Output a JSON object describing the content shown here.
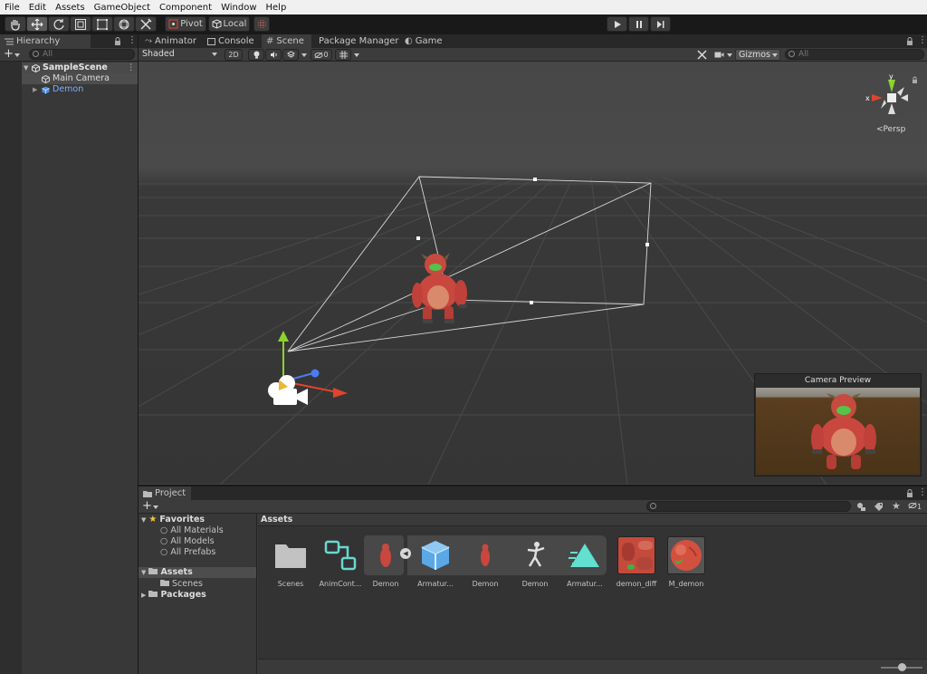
{
  "menu": [
    "File",
    "Edit",
    "Assets",
    "GameObject",
    "Component",
    "Window",
    "Help"
  ],
  "toolbar": {
    "pivot": "Pivot",
    "local": "Local"
  },
  "hierarchy": {
    "tab": "Hierarchy",
    "search_placeholder": "All",
    "scene": "SampleScene",
    "items": [
      "Main Camera",
      "Demon"
    ]
  },
  "scene_tabs": [
    "Animator",
    "Console",
    "Scene",
    "Package Manager",
    "Game"
  ],
  "scene_toolbar": {
    "shading": "Shaded",
    "mode2d": "2D",
    "hidden_count": "0",
    "gizmos": "Gizmos",
    "search_placeholder": "All"
  },
  "gizmo": {
    "y": "y",
    "x": "x",
    "projection": "Persp"
  },
  "camera_preview": {
    "title": "Camera Preview"
  },
  "project": {
    "tab": "Project",
    "favorites": "Favorites",
    "favorite_items": [
      "All Materials",
      "All Models",
      "All Prefabs"
    ],
    "assets": "Assets",
    "asset_children": [
      "Scenes"
    ],
    "packages": "Packages",
    "breadcrumb": "Assets",
    "hidden_count": "1"
  },
  "assets": [
    {
      "label": "Scenes",
      "icon": "folder-icon"
    },
    {
      "label": "AnimCont...",
      "icon": "animator-controller-icon"
    },
    {
      "label": "Demon",
      "icon": "model-prefab-icon"
    },
    {
      "label": "Armatur...",
      "icon": "avatar-cube-icon"
    },
    {
      "label": "Demon",
      "icon": "mesh-icon"
    },
    {
      "label": "Demon",
      "icon": "animation-clip-icon"
    },
    {
      "label": "Armatur...",
      "icon": "avatar-mask-icon"
    },
    {
      "label": "demon_diff",
      "icon": "texture-icon"
    },
    {
      "label": "M_demon",
      "icon": "material-sphere-icon"
    }
  ],
  "colors": {
    "accent_blue": "#4c8ee7",
    "axis_x": "#e0442c",
    "axis_y": "#8ad42c",
    "axis_z": "#4a7cf0",
    "demon": "#c9473f",
    "selection": "#2c5d87"
  }
}
